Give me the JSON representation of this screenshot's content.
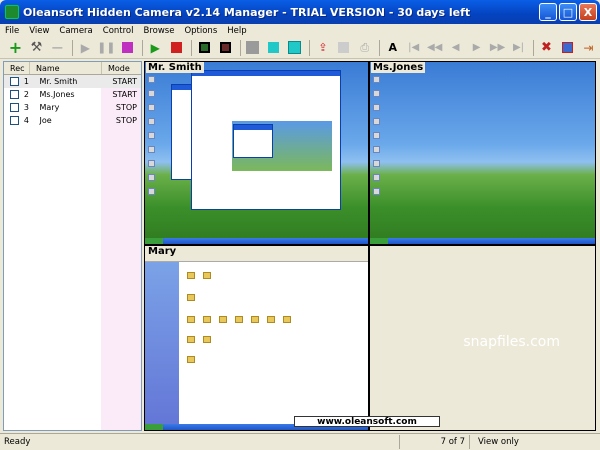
{
  "window": {
    "title": "Oleansoft Hidden Camera v2.14 Manager - TRIAL VERSION - 30 days left",
    "min_label": "_",
    "max_label": "□",
    "close_label": "X"
  },
  "menu": [
    "File",
    "View",
    "Camera",
    "Control",
    "Browse",
    "Options",
    "Help"
  ],
  "toolbar": {
    "icons": [
      "add-camera-icon",
      "tools-icon",
      "remove-icon",
      "play-icon",
      "pause-icon",
      "stop-icon",
      "play-all-icon",
      "stop-all-icon",
      "grid-layout-icon",
      "grid-layout-2-icon",
      "view-single-icon",
      "view-quad-icon",
      "view-multi-icon",
      "export-icon",
      "save-icon",
      "print-icon",
      "zoom-icon",
      "first-frame-icon",
      "prev-frame-icon",
      "prev-icon",
      "next-icon",
      "next-frame-icon",
      "last-frame-icon",
      "delete-icon",
      "settings-icon",
      "exit-icon"
    ]
  },
  "camera_list": {
    "columns": [
      "Rec",
      "Name",
      "Mode"
    ],
    "rows": [
      {
        "num": "1",
        "name": "Mr. Smith",
        "mode": "START"
      },
      {
        "num": "2",
        "name": "Ms.Jones",
        "mode": "START"
      },
      {
        "num": "3",
        "name": "Mary",
        "mode": "STOP"
      },
      {
        "num": "4",
        "name": "Joe",
        "mode": "STOP"
      }
    ]
  },
  "views": {
    "cam1_label": "Mr. Smith",
    "cam2_label": "Ms.Jones",
    "cam3_label": "Mary",
    "watermark": "www.oleansoft.com"
  },
  "overlay_text": "snapfiles.com",
  "status": {
    "left": "Ready",
    "count": "7 of 7",
    "mode": "View only"
  }
}
